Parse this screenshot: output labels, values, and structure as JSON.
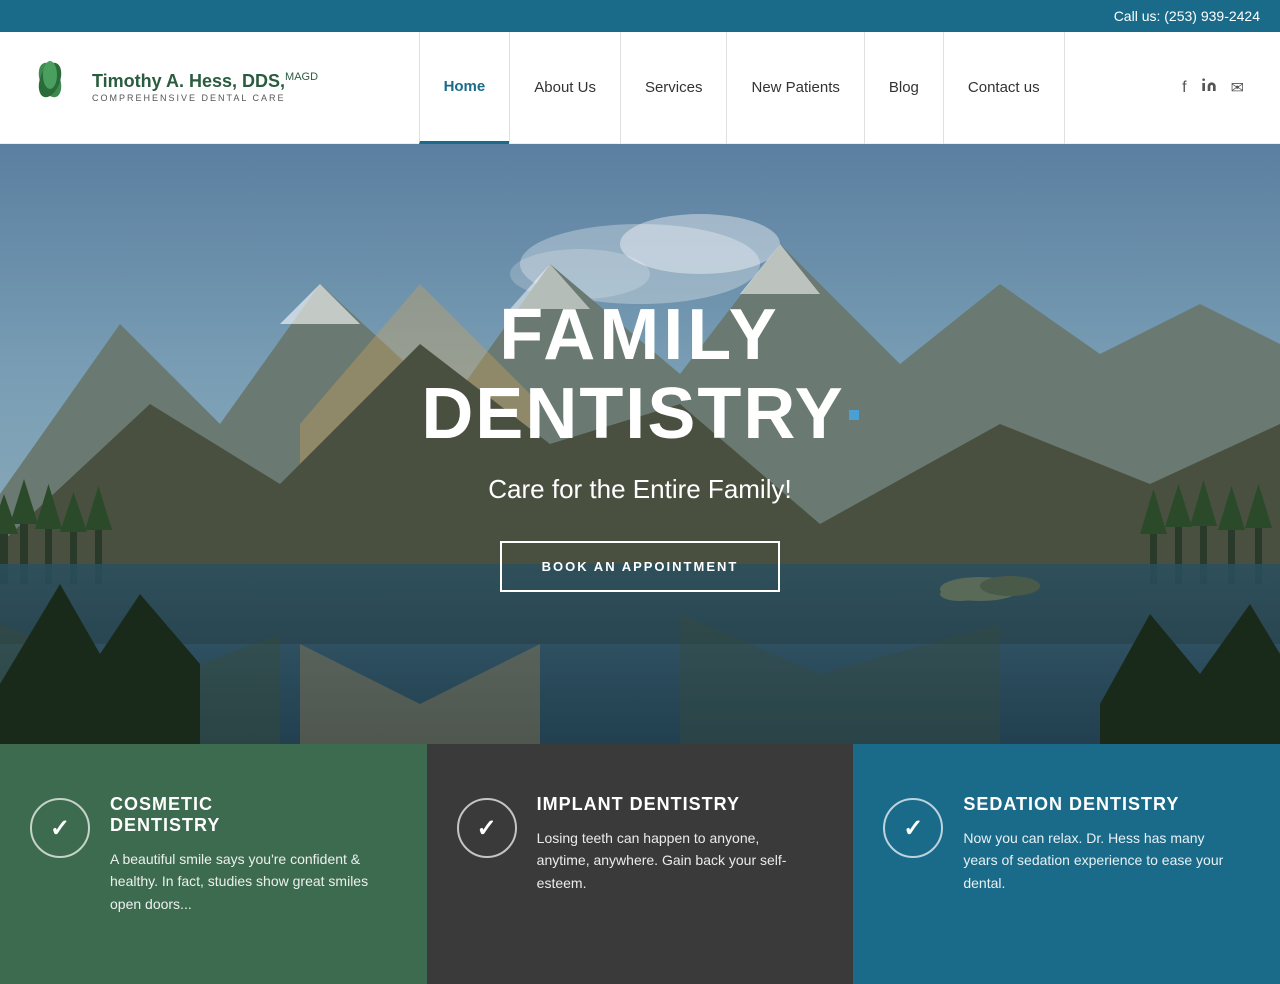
{
  "topbar": {
    "phone_label": "Call us: (253) 939-2424"
  },
  "header": {
    "logo": {
      "name": "Timothy A. Hess, DDS,",
      "suffix": "MAGD",
      "tagline": "COMPREHENSIVE DENTAL CARE"
    },
    "nav": {
      "items": [
        {
          "label": "Home",
          "active": true
        },
        {
          "label": "About Us",
          "active": false
        },
        {
          "label": "Services",
          "active": false
        },
        {
          "label": "New Patients",
          "active": false
        },
        {
          "label": "Blog",
          "active": false
        },
        {
          "label": "Contact us",
          "active": false
        }
      ]
    },
    "social": {
      "facebook": "f",
      "linkedin": "in",
      "email": "✉"
    }
  },
  "hero": {
    "title_line1": "FAMILY",
    "title_line2": "DENTISTRY",
    "tagline": "Care for the Entire Family!",
    "cta_button": "BOOK AN APPOINTMENT"
  },
  "services": [
    {
      "title": "COSMETIC\nDENTISTRY",
      "description": "A beautiful smile says you're confident & healthy. In fact, studies show great smiles open doors..."
    },
    {
      "title": "IMPLANT DENTISTRY",
      "description": "Losing teeth can happen to anyone, anytime, anywhere. Gain back your self-esteem."
    },
    {
      "title": "SEDATION DENTISTRY",
      "description": "Now you can relax. Dr. Hess has many years of sedation experience to ease your dental."
    }
  ]
}
